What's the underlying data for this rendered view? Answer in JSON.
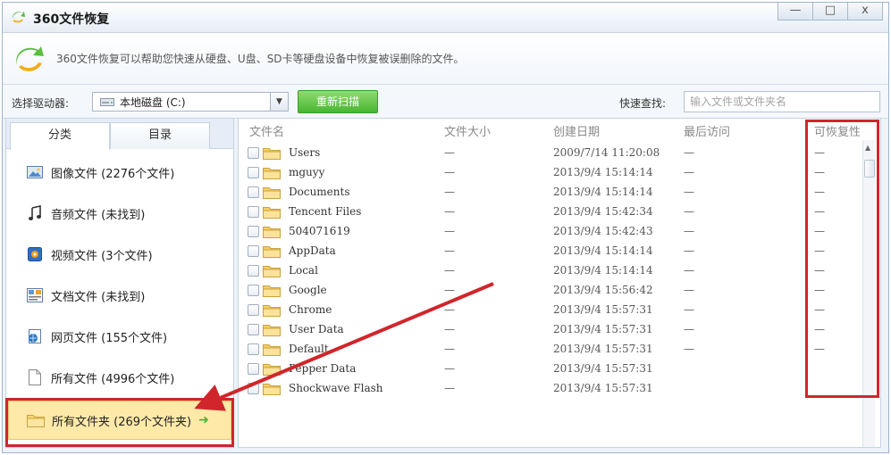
{
  "window": {
    "title": "360文件恢复",
    "minimize_label": "—",
    "maximize_label": "□",
    "close_label": "x"
  },
  "info": {
    "text": "360文件恢复可以帮助您快速从硬盘、U盘、SD卡等硬盘设备中恢复被误删除的文件。"
  },
  "toolbar": {
    "drive_label": "选择驱动器:",
    "drive_value": "本地磁盘 (C:)",
    "rescan_label": "重新扫描",
    "quick_label": "快速查找:",
    "quick_placeholder": "输入文件或文件夹名"
  },
  "tabs": [
    {
      "label": "分类"
    },
    {
      "label": "目录"
    }
  ],
  "categories": [
    {
      "label": "图像文件 (2276个文件)",
      "icon": "image-icon"
    },
    {
      "label": "音频文件 (未找到)",
      "icon": "music-icon"
    },
    {
      "label": "视频文件 (3个文件)",
      "icon": "video-icon"
    },
    {
      "label": "文档文件 (未找到)",
      "icon": "document-icon"
    },
    {
      "label": "网页文件 (155个文件)",
      "icon": "webpage-icon"
    },
    {
      "label": "所有文件 (4996个文件)",
      "icon": "file-icon"
    },
    {
      "label": "所有文件夹 (269个文件夹)",
      "icon": "folder-icon",
      "action": "➜"
    }
  ],
  "columns": [
    "文件名",
    "文件大小",
    "创建日期",
    "最后访问",
    "可恢复性"
  ],
  "files": [
    {
      "name": "Users",
      "size": "—",
      "created": "2009/7/14 11:20:08",
      "accessed": "—",
      "recover": "—"
    },
    {
      "name": "mguyy",
      "size": "—",
      "created": "2013/9/4 15:14:14",
      "accessed": "—",
      "recover": "—"
    },
    {
      "name": "Documents",
      "size": "—",
      "created": "2013/9/4 15:14:14",
      "accessed": "—",
      "recover": "—"
    },
    {
      "name": "Tencent Files",
      "size": "—",
      "created": "2013/9/4 15:42:34",
      "accessed": "—",
      "recover": "—"
    },
    {
      "name": "504071619",
      "size": "—",
      "created": "2013/9/4 15:42:43",
      "accessed": "—",
      "recover": "—"
    },
    {
      "name": "AppData",
      "size": "—",
      "created": "2013/9/4 15:14:14",
      "accessed": "—",
      "recover": "—"
    },
    {
      "name": "Local",
      "size": "—",
      "created": "2013/9/4 15:14:14",
      "accessed": "—",
      "recover": "—"
    },
    {
      "name": "Google",
      "size": "—",
      "created": "2013/9/4 15:56:42",
      "accessed": "—",
      "recover": "—"
    },
    {
      "name": "Chrome",
      "size": "—",
      "created": "2013/9/4 15:57:31",
      "accessed": "—",
      "recover": "—"
    },
    {
      "name": "User Data",
      "size": "—",
      "created": "2013/9/4 15:57:31",
      "accessed": "—",
      "recover": "—"
    },
    {
      "name": "Default",
      "size": "—",
      "created": "2013/9/4 15:57:31",
      "accessed": "—",
      "recover": "—"
    },
    {
      "name": "Pepper Data",
      "size": "—",
      "created": "2013/9/4 15:57:31",
      "accessed": "",
      "recover": ""
    },
    {
      "name": "Shockwave Flash",
      "size": "—",
      "created": "2013/9/4 15:57:31",
      "accessed": "",
      "recover": ""
    }
  ],
  "colors": {
    "highlight": "#d0262b",
    "accent_green": "#47b532",
    "selected_row": "#ffe9a8"
  }
}
